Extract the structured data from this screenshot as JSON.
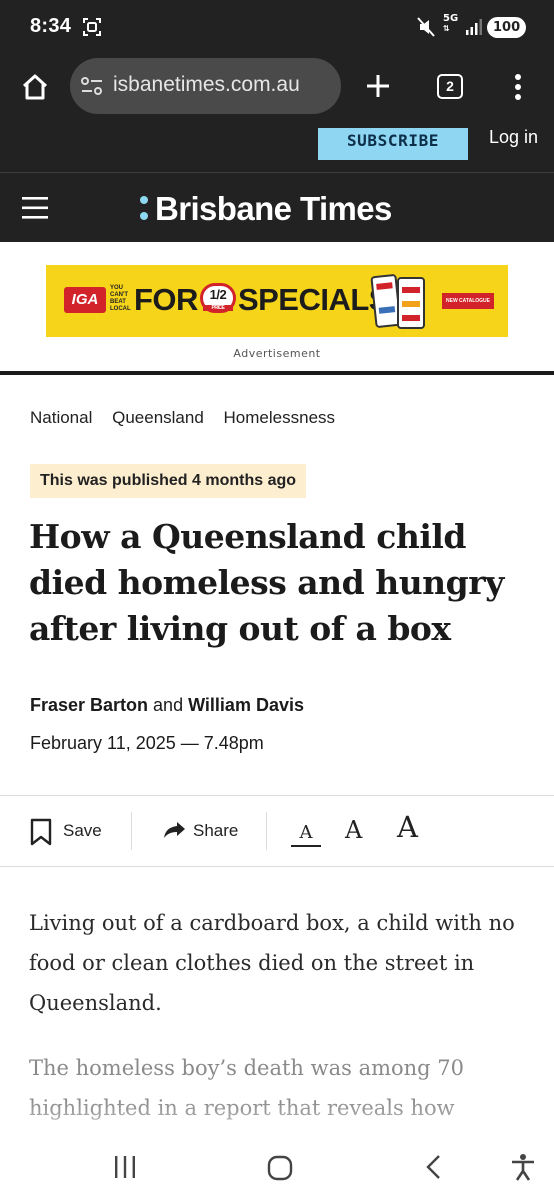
{
  "status_bar": {
    "time": "8:34",
    "network": "5G",
    "battery": "100"
  },
  "browser": {
    "url": "isbanetimes.com.au",
    "tab_count": "2"
  },
  "site_header": {
    "subscribe_label": "SUBSCRIBE",
    "login_label": "Log in",
    "brand_name": "Brisbane Times",
    "accent_color": "#8fd6f2"
  },
  "ad": {
    "brand": "IGA",
    "tagline": "YOU CAN'T BEAT LOCAL",
    "headline_left": "FOR",
    "half_num": "1/2",
    "half_sub": "PRICE",
    "headline_right": "SPECIALS",
    "cta": "NEW CATALOGUE",
    "label": "Advertisement"
  },
  "article": {
    "breadcrumbs": [
      "National",
      "Queensland",
      "Homelessness"
    ],
    "published_notice": "This was published 4 months ago",
    "headline": "How a Queensland child died homeless and hungry after living out of a box",
    "author_1": "Fraser Barton",
    "author_joiner": " and ",
    "author_2": "William Davis",
    "date": "February 11, 2025 — 7.48pm",
    "paragraph_1": "Living out of a cardboard box, a child with no food or clean clothes died on the street in Queensland.",
    "paragraph_2": "The homeless boy’s death was among 70 highlighted in a report that reveals how"
  },
  "toolbar": {
    "save_label": "Save",
    "share_label": "Share",
    "font_small": "A",
    "font_medium": "A",
    "font_large": "A"
  },
  "icons": {
    "home": "home-icon",
    "site_info": "tune-icon",
    "new_tab": "plus-icon",
    "menu": "more-vert-icon",
    "nav_menu": "hamburger-icon",
    "save": "bookmark-icon",
    "share": "share-arrow-icon"
  }
}
